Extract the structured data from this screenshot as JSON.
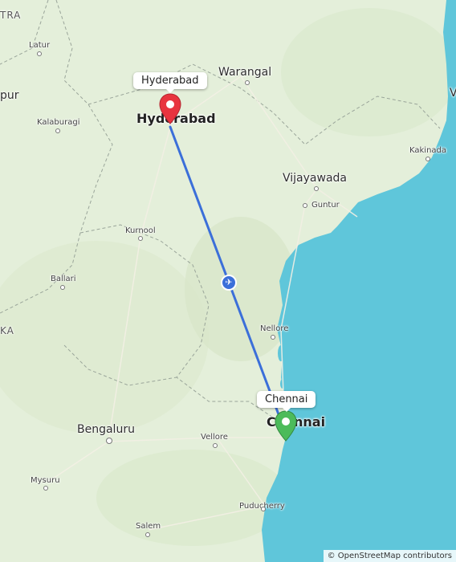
{
  "map": {
    "places": {
      "hyderabad": "Hyderabad",
      "warangal": "Warangal",
      "vijayawada": "Vijayawada",
      "guntur": "Guntur",
      "kakinada": "Kakinada",
      "kurnool": "Kurnool",
      "ballari": "Ballari",
      "nellore": "Nellore",
      "chennai": "Chennai",
      "bengaluru": "Bengaluru",
      "vellore": "Vellore",
      "mysuru": "Mysuru",
      "puducherry": "Puducherry",
      "salem": "Salem",
      "latur": "Latur",
      "kalaburagi": "Kalaburagi"
    },
    "edge_labels": {
      "tra": "TRA",
      "pur": "pur",
      "ka": "KA",
      "v": "V"
    },
    "callouts": {
      "origin": "Hyderabad",
      "destination": "Chennai"
    },
    "route": {
      "mode_icon": "airplane-icon",
      "line_color": "#3b6fd9",
      "origin_pin_color": "#e8343f",
      "destination_pin_color": "#4cbb5a"
    },
    "attribution": "© OpenStreetMap contributors"
  }
}
